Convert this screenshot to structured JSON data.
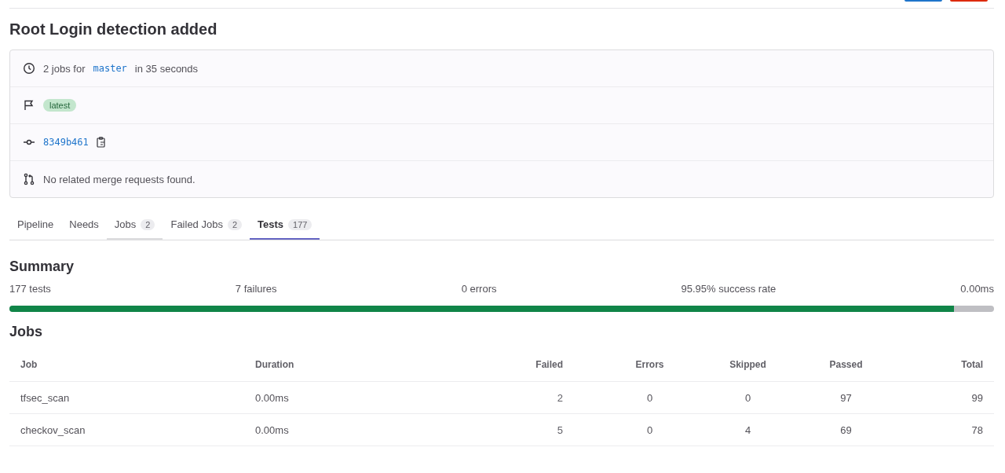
{
  "header_buttons": [
    {
      "color": "#1f75cb"
    },
    {
      "color": "#dd2b0e"
    }
  ],
  "title": "Root Login detection added",
  "info": [
    {
      "kind": "duration",
      "before": "2 jobs for",
      "ref": "master",
      "after": "in 35 seconds"
    },
    {
      "kind": "badge",
      "badge": "latest"
    },
    {
      "kind": "commit",
      "sha": "8349b461"
    },
    {
      "kind": "merge",
      "text": "No related merge requests found."
    }
  ],
  "tabs": [
    {
      "label": "Pipeline",
      "selected": false,
      "hovered": false
    },
    {
      "label": "Needs",
      "selected": false,
      "hovered": false
    },
    {
      "label": "Jobs",
      "count": "2",
      "selected": false,
      "hovered": true
    },
    {
      "label": "Failed Jobs",
      "count": "2",
      "selected": false,
      "hovered": false
    },
    {
      "label": "Tests",
      "count": "177",
      "selected": true,
      "hovered": false
    }
  ],
  "summary": {
    "title": "Summary",
    "stats": [
      "177 tests",
      "7 failures",
      "0 errors",
      "95.95% success rate",
      "0.00ms"
    ],
    "level": 0.9595
  },
  "jobs": {
    "title": "Jobs",
    "columns": [
      "Job",
      "Duration",
      "Failed",
      "Errors",
      "Skipped",
      "Passed",
      "Total"
    ],
    "rows": [
      [
        "tfsec_scan",
        "0.00ms",
        "2",
        "0",
        "0",
        "97",
        "99"
      ],
      [
        "checkov_scan",
        "0.00ms",
        "5",
        "0",
        "4",
        "69",
        "78"
      ]
    ]
  }
}
